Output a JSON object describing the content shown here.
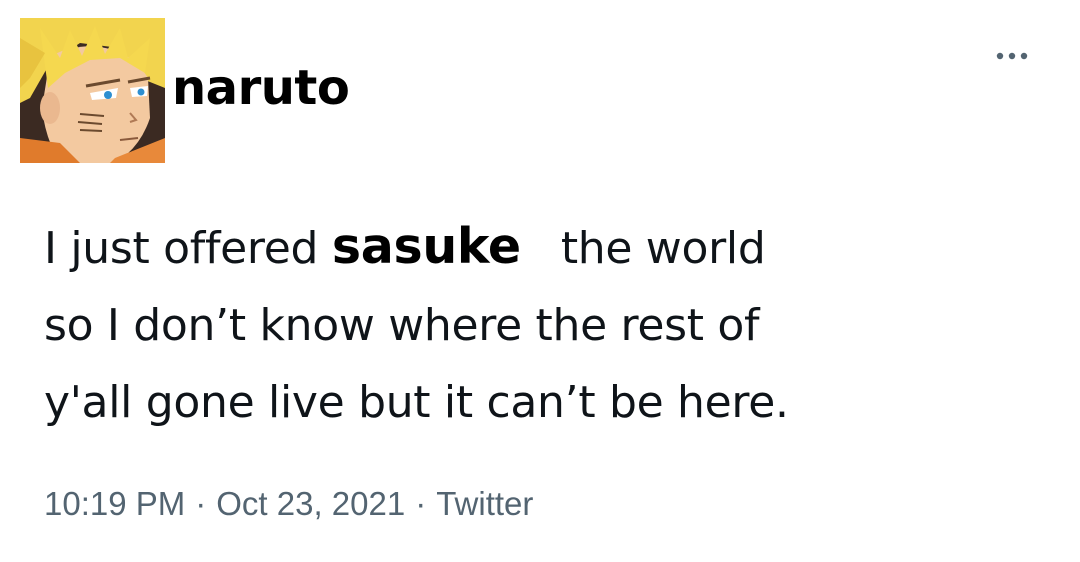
{
  "header": {
    "display_name": "naruto",
    "avatar_icon": "naruto-avatar",
    "more_icon": "more-horizontal-icon"
  },
  "tweet": {
    "line1_before": "I just offered ",
    "mention": "sasuke",
    "line1_after": "the world",
    "line2": "so I don’t know where the rest of",
    "line3": "y'all gone live but it can’t be here."
  },
  "meta": {
    "time": "10:19 PM",
    "separator": "·",
    "date": "Oct 23, 2021",
    "source": "Twitter"
  },
  "colors": {
    "text": "#0f1419",
    "muted": "#536471",
    "background": "#ffffff"
  }
}
